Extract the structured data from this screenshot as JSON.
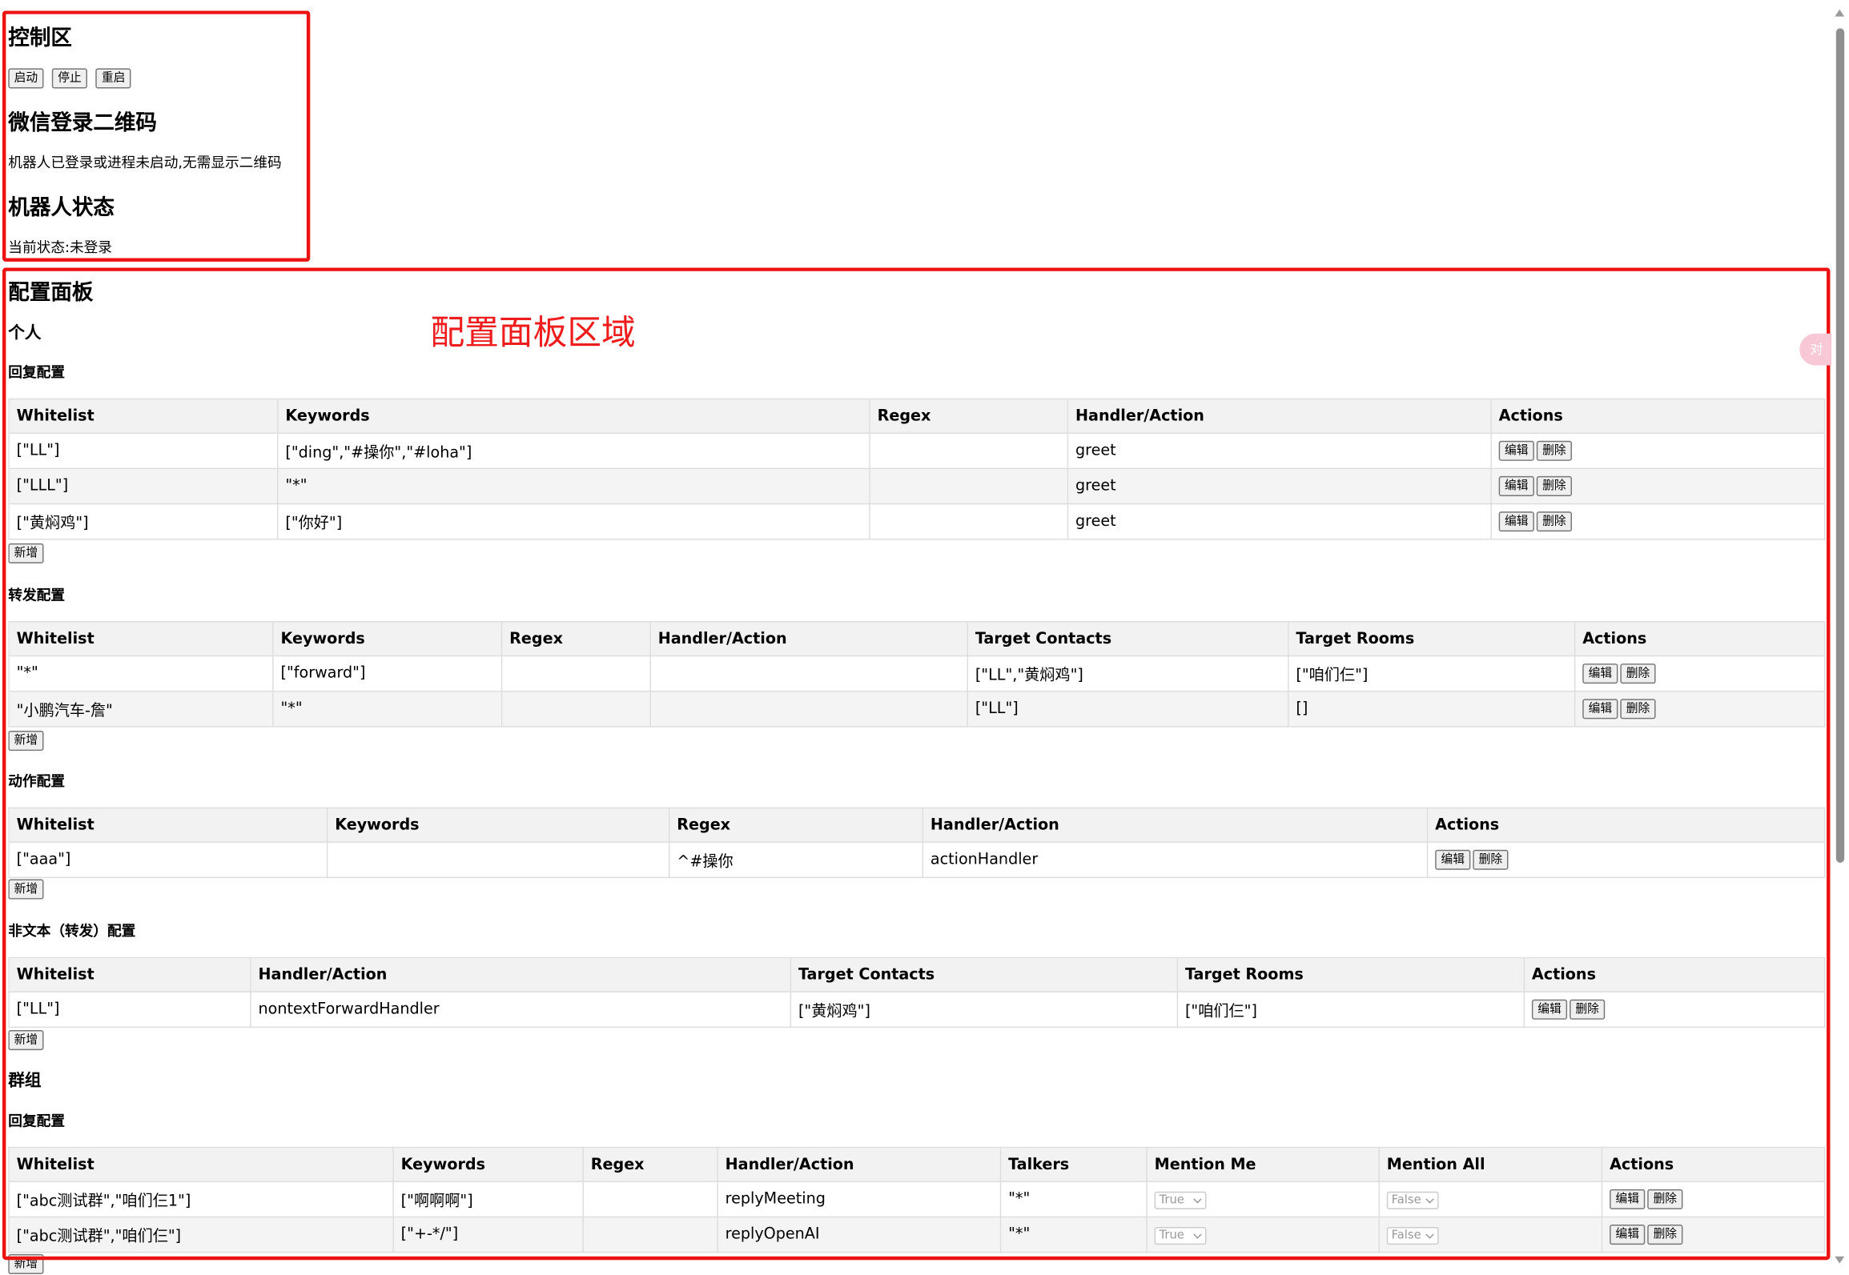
{
  "control": {
    "title": "控制区",
    "start_label": "启动",
    "stop_label": "停止",
    "restart_label": "重启"
  },
  "qr": {
    "title": "微信登录二维码",
    "message": "机器人已登录或进程未启动,无需显示二维码"
  },
  "bot_status": {
    "title": "机器人状态",
    "status_text": "当前状态:未登录"
  },
  "annotation": "配置面板区域",
  "side_bubble": "对",
  "config": {
    "title": "配置面板",
    "personal": {
      "title": "个人",
      "reply": {
        "title": "回复配置",
        "headers": [
          "Whitelist",
          "Keywords",
          "Regex",
          "Handler/Action",
          "Actions"
        ],
        "rows": [
          [
            "[\"LL\"]",
            "[\"ding\",\"#操你\",\"#loha\"]",
            "",
            "greet"
          ],
          [
            "[\"LLL\"]",
            "\"*\"",
            "",
            "greet"
          ],
          [
            "[\"黄焖鸡\"]",
            "[\"你好\"]",
            "",
            "greet"
          ]
        ]
      },
      "forward": {
        "title": "转发配置",
        "headers": [
          "Whitelist",
          "Keywords",
          "Regex",
          "Handler/Action",
          "Target Contacts",
          "Target Rooms",
          "Actions"
        ],
        "rows": [
          [
            "\"*\"",
            "[\"forward\"]",
            "",
            "",
            "[\"LL\",\"黄焖鸡\"]",
            "[\"咱们仨\"]"
          ],
          [
            "\"小鹏汽车-詹\"",
            "\"*\"",
            "",
            "",
            "[\"LL\"]",
            "[]"
          ]
        ]
      },
      "action": {
        "title": "动作配置",
        "headers": [
          "Whitelist",
          "Keywords",
          "Regex",
          "Handler/Action",
          "Actions"
        ],
        "rows": [
          [
            "[\"aaa\"]",
            "",
            "^#操你",
            "actionHandler"
          ]
        ]
      },
      "nontext": {
        "title": "非文本（转发）配置",
        "headers": [
          "Whitelist",
          "Handler/Action",
          "Target Contacts",
          "Target Rooms",
          "Actions"
        ],
        "rows": [
          [
            "[\"LL\"]",
            "nontextForwardHandler",
            "[\"黄焖鸡\"]",
            "[\"咱们仨\"]"
          ]
        ]
      }
    },
    "group": {
      "title": "群组",
      "reply": {
        "title": "回复配置",
        "headers": [
          "Whitelist",
          "Keywords",
          "Regex",
          "Handler/Action",
          "Talkers",
          "Mention Me",
          "Mention All",
          "Actions"
        ],
        "rows": [
          [
            "[\"abc测试群\",\"咱们仨1\"]",
            "[\"啊啊啊\"]",
            "",
            "replyMeeting",
            "\"*\"",
            "True",
            "False"
          ],
          [
            "[\"abc测试群\",\"咱们仨\"]",
            "[\"+-*/\"]",
            "",
            "replyOpenAI",
            "\"*\"",
            "True",
            "False"
          ]
        ]
      }
    },
    "edit_label": "编辑",
    "delete_label": "删除",
    "add_label": "新增"
  }
}
